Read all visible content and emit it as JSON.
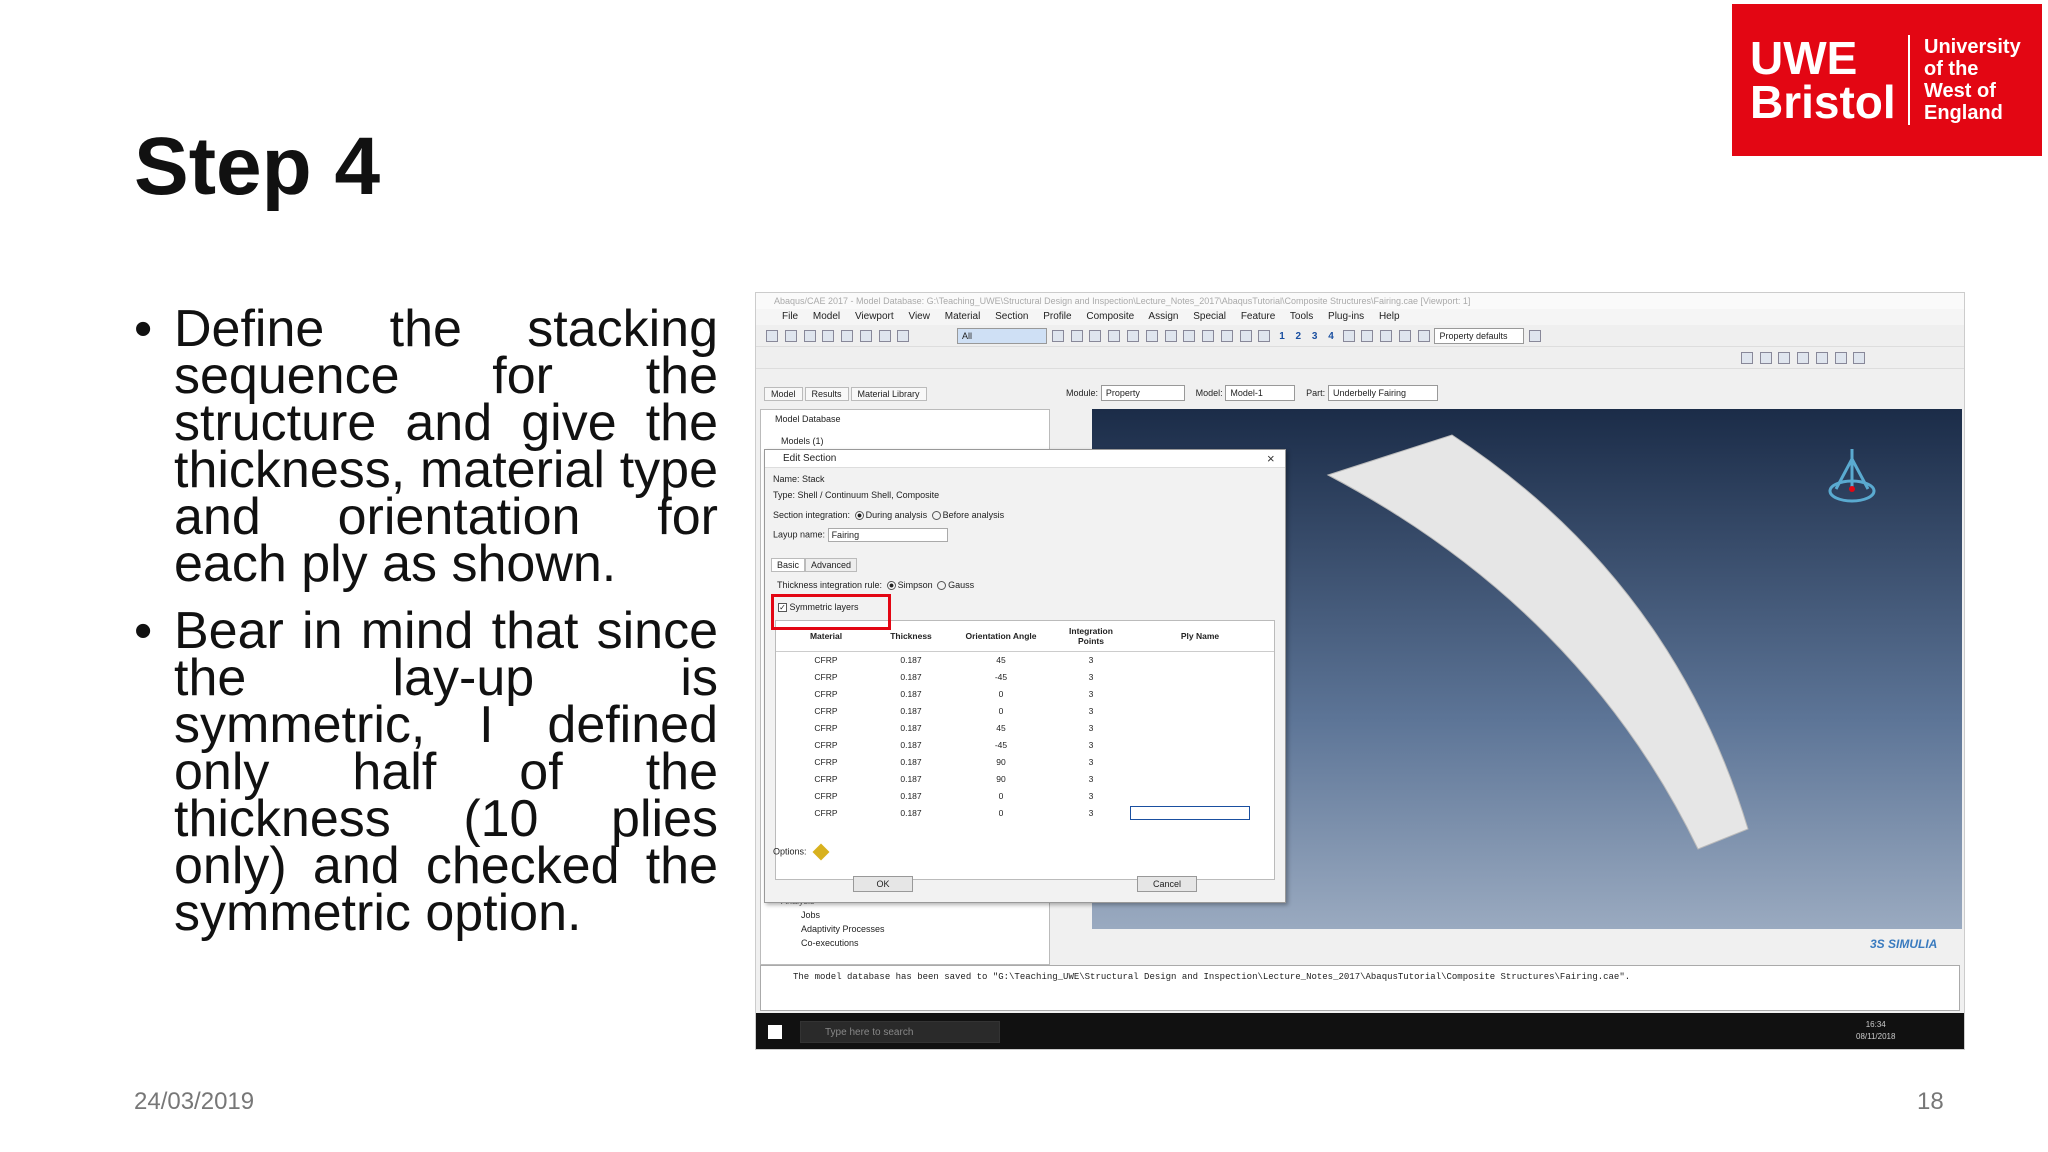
{
  "slide": {
    "title": "Step 4",
    "bullets": [
      "Define the stacking sequence for the structure and give the thickness, material type and orientation for each ply as shown.",
      "Bear in mind that since the lay-up is symmetric, I defined only half of the thickness (10 plies only) and checked the symmetric option."
    ],
    "date": "24/03/2019",
    "page_number": "18"
  },
  "logo": {
    "line1": "UWE",
    "line2": "Bristol",
    "sub1": "University",
    "sub2": "of the",
    "sub3": "West of",
    "sub4": "England",
    "color": "#e30613"
  },
  "app": {
    "window_title": "Abaqus/CAE 2017 - Model Database: G:\\Teaching_UWE\\Structural Design and Inspection\\Lecture_Notes_2017\\AbaqusTutorial\\Composite Structures\\Fairing.cae [Viewport: 1]",
    "menu": [
      "File",
      "Model",
      "Viewport",
      "View",
      "Material",
      "Section",
      "Profile",
      "Composite",
      "Assign",
      "Special",
      "Feature",
      "Tools",
      "Plug-ins",
      "Help"
    ],
    "toolbar_filter": "All",
    "toolbar_numbers": [
      "1",
      "2",
      "3",
      "4"
    ],
    "property_defaults": "Property defaults",
    "left_tabs": [
      "Model",
      "Results",
      "Material Library"
    ],
    "module_label": "Module:",
    "module_value": "Property",
    "model_label": "Model:",
    "model_value": "Model-1",
    "part_label": "Part:",
    "part_value": "Underbelly Fairing",
    "tree": {
      "root": "Model Database",
      "models": "Models (1)",
      "analysis": "Analysis",
      "jobs": "Jobs",
      "adaptivity": "Adaptivity Processes",
      "coexec": "Co-executions"
    },
    "message": "The model database has been saved to \"G:\\Teaching_UWE\\Structural Design and Inspection\\Lecture_Notes_2017\\AbaqusTutorial\\Composite Structures\\Fairing.cae\".",
    "simulia": "3S SIMULIA",
    "taskbar": {
      "search_placeholder": "Type here to search",
      "time": "16:34",
      "date": "08/11/2018"
    }
  },
  "dialog": {
    "title": "Edit Section",
    "name_label": "Name:",
    "name_value": "Stack",
    "type_label": "Type:",
    "type_value": "Shell / Continuum Shell, Composite",
    "integration_label": "Section integration:",
    "integration_options": [
      "During analysis",
      "Before analysis"
    ],
    "layup_label": "Layup name:",
    "layup_value": "Fairing",
    "tabs": [
      "Basic",
      "Advanced"
    ],
    "rule_label": "Thickness integration rule:",
    "rule_options": [
      "Simpson",
      "Gauss"
    ],
    "symmetric_label": "Symmetric layers",
    "columns": [
      "Material",
      "Thickness",
      "Orientation Angle",
      "Integration Points",
      "Ply Name"
    ],
    "rows": [
      [
        "CFRP",
        "0.187",
        "45",
        "3",
        ""
      ],
      [
        "CFRP",
        "0.187",
        "-45",
        "3",
        ""
      ],
      [
        "CFRP",
        "0.187",
        "0",
        "3",
        ""
      ],
      [
        "CFRP",
        "0.187",
        "0",
        "3",
        ""
      ],
      [
        "CFRP",
        "0.187",
        "45",
        "3",
        ""
      ],
      [
        "CFRP",
        "0.187",
        "-45",
        "3",
        ""
      ],
      [
        "CFRP",
        "0.187",
        "90",
        "3",
        ""
      ],
      [
        "CFRP",
        "0.187",
        "90",
        "3",
        ""
      ],
      [
        "CFRP",
        "0.187",
        "0",
        "3",
        ""
      ],
      [
        "CFRP",
        "0.187",
        "0",
        "3",
        ""
      ]
    ],
    "options_label": "Options:",
    "ok": "OK",
    "cancel": "Cancel",
    "highlight_color": "#e30613"
  }
}
